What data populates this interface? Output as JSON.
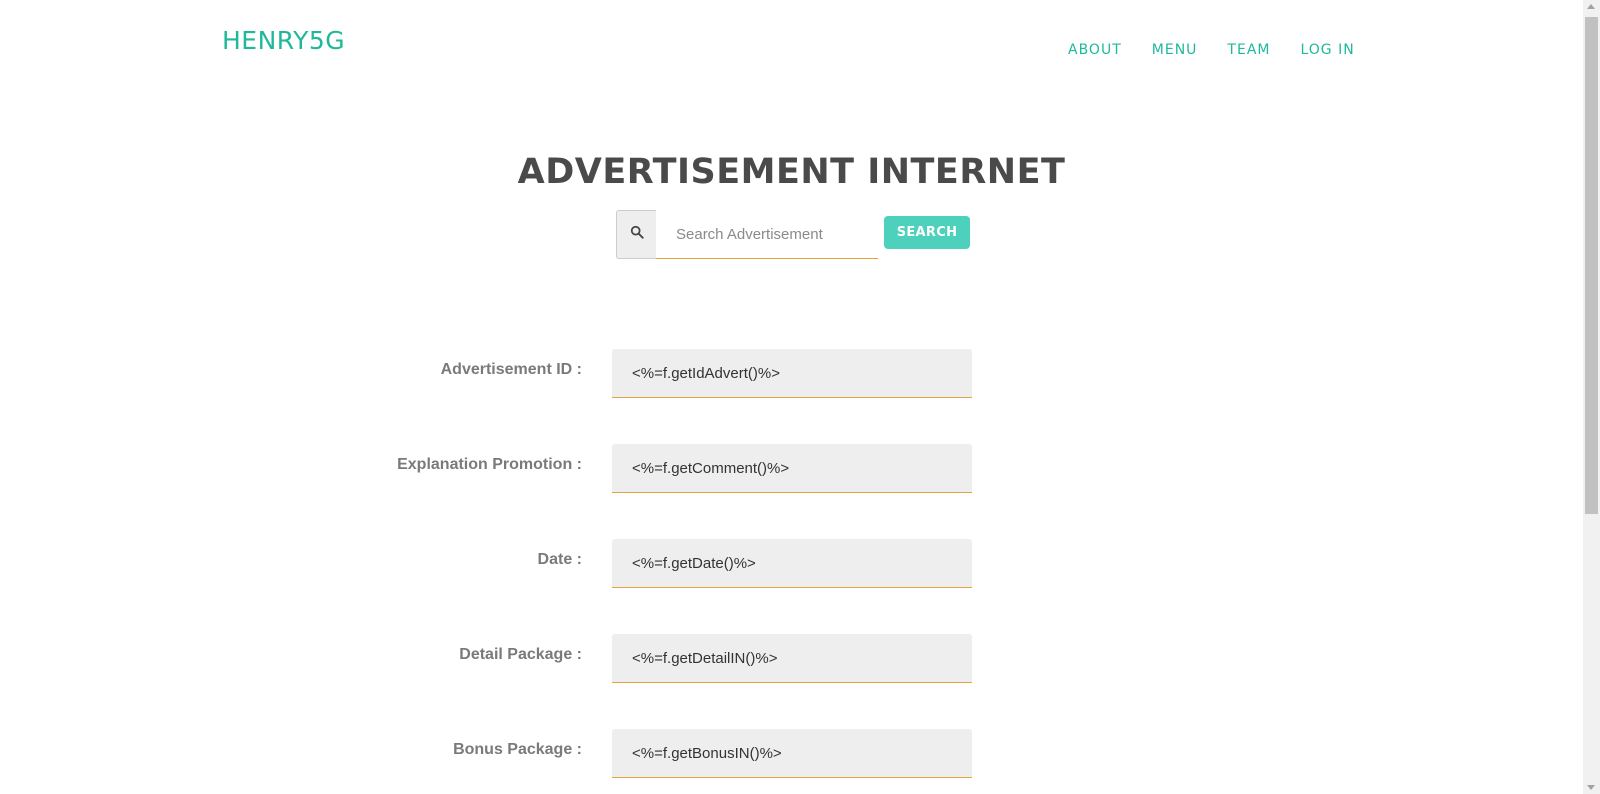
{
  "header": {
    "brand": "HENRY5G",
    "nav": [
      "ABOUT",
      "MENU",
      "TEAM",
      "LOG IN"
    ]
  },
  "main": {
    "title": "ADVERTISEMENT INTERNET",
    "search": {
      "placeholder": "Search Advertisement",
      "value": "",
      "button_label": "SEARCH",
      "icon": "search-icon"
    },
    "fields": [
      {
        "label": "Advertisement ID :",
        "value": "<%=f.getIdAdvert()%>"
      },
      {
        "label": "Explanation Promotion :",
        "value": "<%=f.getComment()%>"
      },
      {
        "label": "Date :",
        "value": "<%=f.getDate()%>"
      },
      {
        "label": "Detail Package :",
        "value": "<%=f.getDetailIN()%>"
      },
      {
        "label": "Bonus Package :",
        "value": "<%=f.getBonusIN()%>"
      }
    ]
  },
  "colors": {
    "accent": "#1fb99a",
    "button": "#4dd0bc",
    "underline": "#e6a23c",
    "field_bg": "#eeeeee"
  }
}
